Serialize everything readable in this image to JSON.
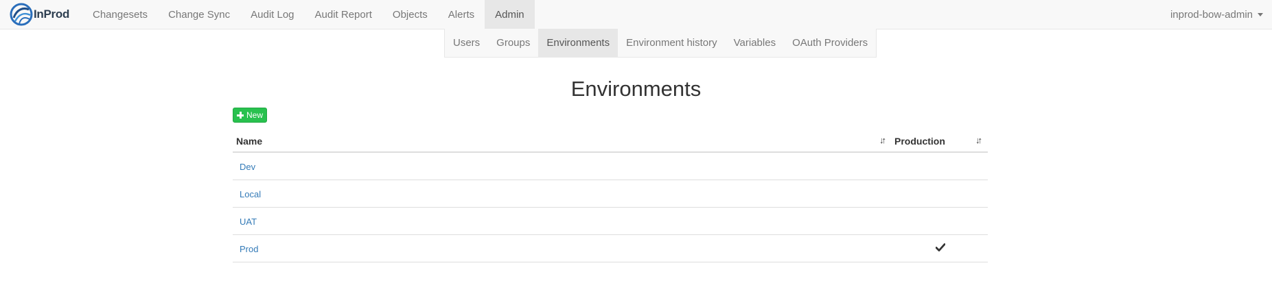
{
  "brand": {
    "name": "InProd"
  },
  "nav": {
    "items": [
      {
        "label": "Changesets",
        "active": false
      },
      {
        "label": "Change Sync",
        "active": false
      },
      {
        "label": "Audit Log",
        "active": false
      },
      {
        "label": "Audit Report",
        "active": false
      },
      {
        "label": "Objects",
        "active": false
      },
      {
        "label": "Alerts",
        "active": false
      },
      {
        "label": "Admin",
        "active": true
      }
    ],
    "user": "inprod-bow-admin"
  },
  "subnav": {
    "items": [
      {
        "label": "Users",
        "active": false
      },
      {
        "label": "Groups",
        "active": false
      },
      {
        "label": "Environments",
        "active": true
      },
      {
        "label": "Environment history",
        "active": false
      },
      {
        "label": "Variables",
        "active": false
      },
      {
        "label": "OAuth Providers",
        "active": false
      }
    ]
  },
  "page": {
    "title": "Environments",
    "new_label": "New"
  },
  "table": {
    "columns": [
      "Name",
      "Production"
    ],
    "rows": [
      {
        "name": "Dev",
        "production": false
      },
      {
        "name": "Local",
        "production": false
      },
      {
        "name": "UAT",
        "production": false
      },
      {
        "name": "Prod",
        "production": true
      }
    ]
  },
  "colors": {
    "accent_green": "#28c14e",
    "link_blue": "#337ab7"
  },
  "icons": {
    "sort": "sort-icon",
    "check": "check-icon",
    "plus": "plus-icon",
    "caret": "caret-down-icon"
  }
}
